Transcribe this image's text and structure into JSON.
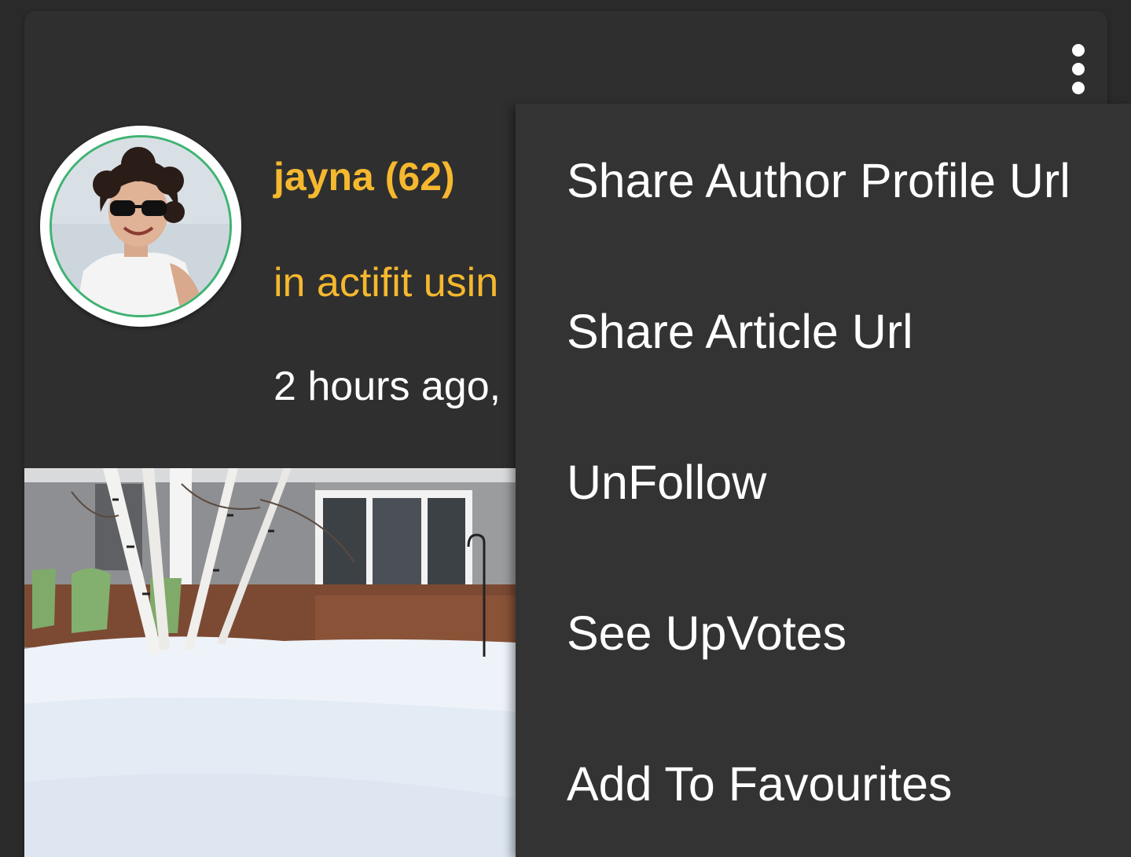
{
  "post": {
    "author": "jayna (62)",
    "community_text": "in actifit usin",
    "timestamp_text": "2 hours ago,"
  },
  "icons": {
    "overflow_menu": "more-vertical-icon",
    "avatar": "user-avatar-photo",
    "post_image": "snowy-house-photo"
  },
  "menu": {
    "items": [
      {
        "label": "Share Author Profile Url"
      },
      {
        "label": "Share Article Url"
      },
      {
        "label": "UnFollow"
      },
      {
        "label": "See UpVotes"
      },
      {
        "label": "Add To Favourites"
      }
    ]
  },
  "colors": {
    "background": "#2a2a2a",
    "card": "#2f2f2f",
    "menu": "#333333",
    "accent_yellow": "#f5b82e",
    "avatar_ring": "#3fb371",
    "text": "#ffffff"
  }
}
